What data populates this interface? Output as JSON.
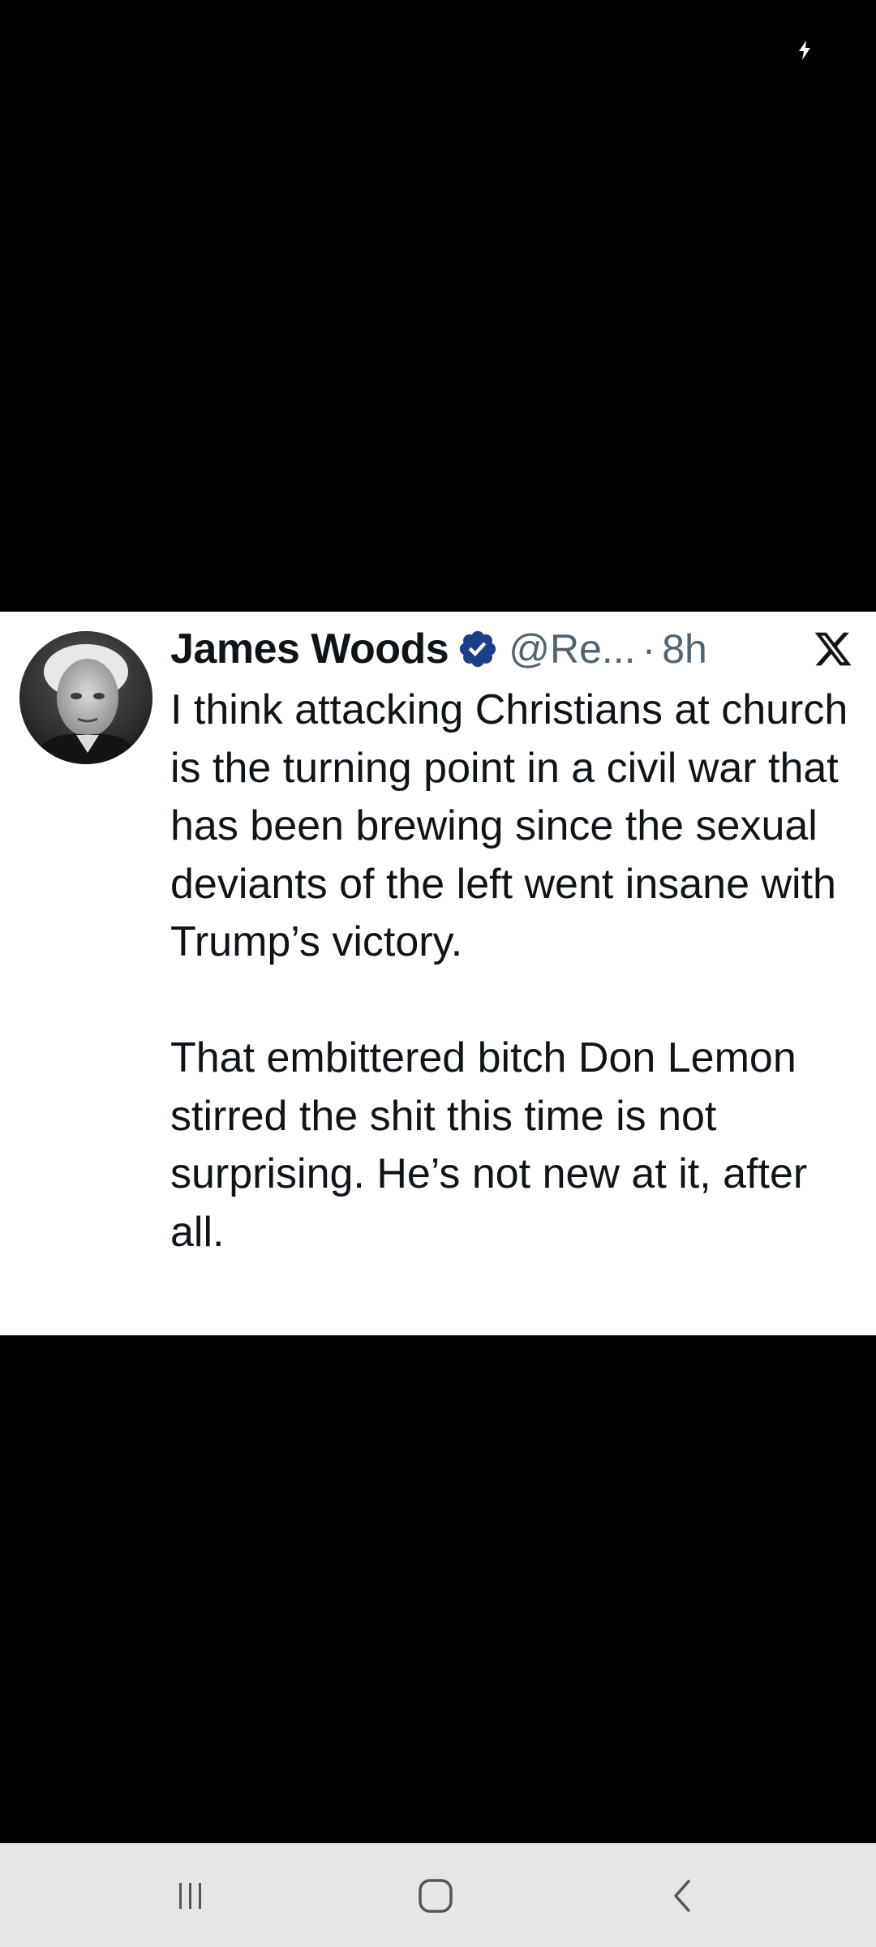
{
  "status_bar": {
    "icons": [
      "charging-bolt-icon"
    ]
  },
  "tweet": {
    "author_name": "James Woods",
    "verified": true,
    "verified_color": "#1d3f8a",
    "handle": "@Re...",
    "separator": "·",
    "timestamp": "8h",
    "brand_icon": "x-logo-icon",
    "paragraphs": [
      "I think attacking Christians at church is the turning point in a civil war that has been brewing since the sexual deviants of the left went insane with Trump’s victory.",
      "That embittered bitch Don Lemon stirred the shit this time is not surprising. He’s not new at it, after all."
    ]
  },
  "nav_bar": {
    "buttons": [
      "recent-apps-icon",
      "home-icon",
      "back-icon"
    ]
  },
  "colors": {
    "background": "#000000",
    "card": "#ffffff",
    "text_primary": "#0f1419",
    "text_secondary": "#536471",
    "nav_bar": "#e6e6e6"
  }
}
